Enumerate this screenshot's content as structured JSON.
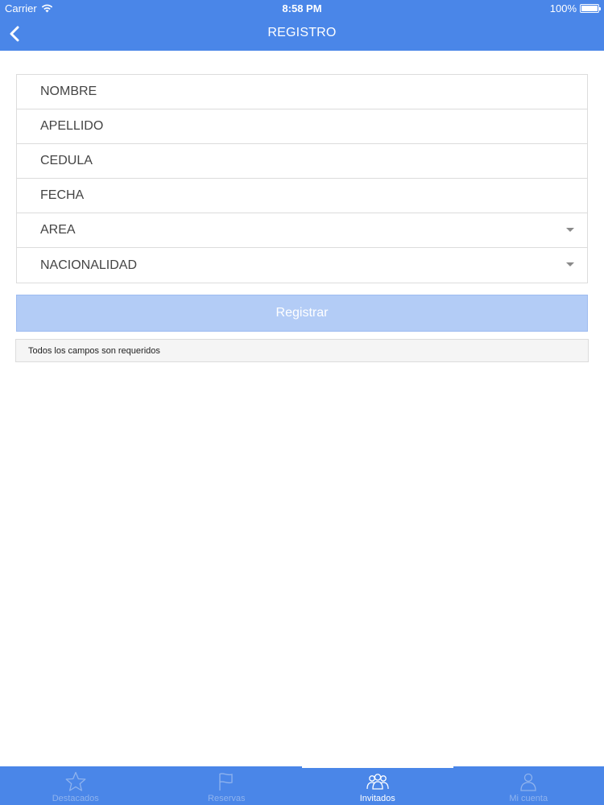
{
  "status_bar": {
    "carrier": "Carrier",
    "time": "8:58 PM",
    "battery": "100%"
  },
  "nav": {
    "title": "REGISTRO"
  },
  "form": {
    "fields": [
      {
        "label": "NOMBRE"
      },
      {
        "label": "APELLIDO"
      },
      {
        "label": "CEDULA"
      },
      {
        "label": "FECHA"
      },
      {
        "label": "AREA"
      },
      {
        "label": "NACIONALIDAD"
      }
    ],
    "submit_label": "Registrar",
    "notice": "Todos los campos son requeridos"
  },
  "tabs": [
    {
      "label": "Destacados",
      "icon": "star-icon",
      "active": false
    },
    {
      "label": "Reservas",
      "icon": "flag-icon",
      "active": false
    },
    {
      "label": "Invitados",
      "icon": "group-icon",
      "active": true
    },
    {
      "label": "Mi cuenta",
      "icon": "user-icon",
      "active": false
    }
  ],
  "colors": {
    "primary": "#4a86e8",
    "button_disabled": "#b3ccf6",
    "tab_inactive": "#8fb3ee"
  }
}
